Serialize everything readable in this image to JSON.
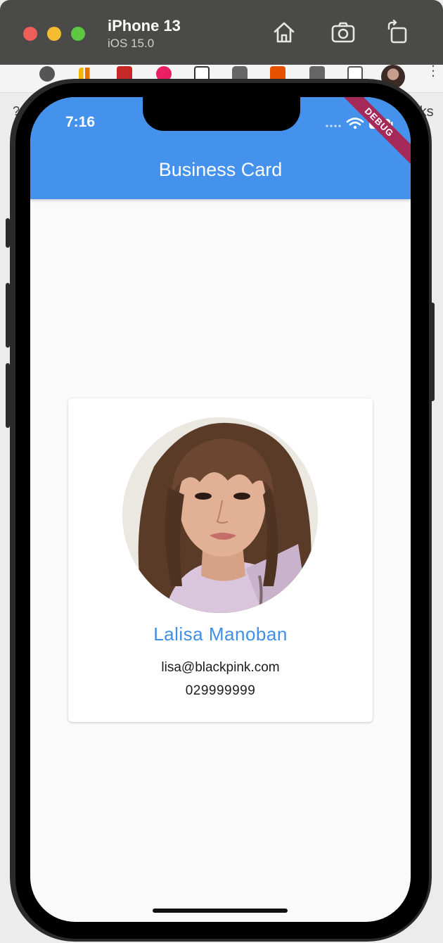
{
  "simulator": {
    "device_name": "iPhone 13",
    "os_version": "iOS 15.0",
    "toolbar_icons": [
      "home-icon",
      "screenshot-icon",
      "rotate-icon"
    ]
  },
  "browser_background": {
    "partial_text_right": "rks",
    "partial_text_left": "?"
  },
  "status_bar": {
    "time": "7:16",
    "icons": [
      "signal-icon",
      "wifi-icon",
      "battery-icon"
    ],
    "debug_banner": "DEBUG"
  },
  "app_bar": {
    "title": "Business Card",
    "color": "#4592ec"
  },
  "card": {
    "name": "Lalisa Manoban",
    "email": "lisa@blackpink.com",
    "phone": "029999999",
    "name_color": "#3f8fe8"
  }
}
